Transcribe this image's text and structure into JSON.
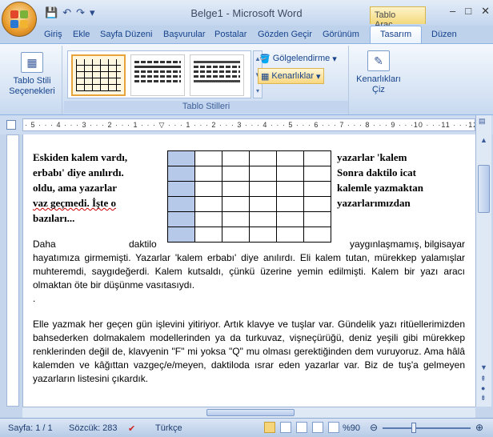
{
  "window": {
    "title": "Belge1 - Microsoft Word",
    "context_tab": "Tablo Araç...",
    "minimize": "–",
    "maximize": "□",
    "close": "✕"
  },
  "tabs": [
    "Giriş",
    "Ekle",
    "Sayfa Düzeni",
    "Başvurular",
    "Postalar",
    "Gözden Geçir",
    "Görünüm",
    "Tasarım",
    "Düzen"
  ],
  "active_tab": "Tasarım",
  "ribbon": {
    "table_style_options": "Tablo Stili Seçenekleri",
    "shading": "Gölgelendirme",
    "borders": "Kenarlıklar",
    "draw_borders": "Kenarlıkları Çiz",
    "group_table_styles": "Tablo Stilleri"
  },
  "ruler": {
    "text": "· 5 · · · 4 · · · 3 · · · 2 · · · 1 · · · ▽ · · · 1 · · · 2 · · · 3 · · · 4 · · · 5 · · · 6 · · · 7 · · · 8 · · · 9 · · ·10 · · ·11 · · ·12 · · ·13 · · ·14 · · ·15"
  },
  "document": {
    "bold_left": [
      "Eskiden kalem vardı,",
      "erbabı' diye anılırdı.",
      "oldu, ama yazarlar",
      "vaz geçmedi. İşte o",
      "bazıları..."
    ],
    "bold_right": [
      "yazarlar 'kalem",
      "Sonra daktilo icat",
      "kalemle yazmaktan",
      "yazarlarımızdan"
    ],
    "para1_start_left": "Daha",
    "para1_start_mid": "daktilo",
    "para1_start_right": "yaygınlaşmamış, bilgisayar",
    "para1_rest": "hayatımıza girmemişti. Yazarlar 'kalem erbabı' diye anılırdı. Eli kalem tutan, mürekkep yalamışlar muhteremdi, saygıdeğerdi. Kalem kutsaldı, çünkü üzerine yemin edilmişti. Kalem bir yazı aracı olmaktan öte bir düşünme vasıtasıydı.",
    "dot": ".",
    "para2": "Elle yazmak her geçen gün işlevini yitiriyor. Artık klavye ve tuşlar var. Gündelik yazı ritüellerimizden bahsederken dolmakalem modellerinden ya da turkuvaz, vişneçürüğü, deniz yeşili gibi mürekkep renklerinden değil de, klavyenin \"F\" mi yoksa \"Q\" mu olması gerektiğinden dem vuruyoruz. Ama hâlâ kalemden ve kâğıttan vazgeç/e/meyen, daktiloda ısrar eden yazarlar var. Biz de tuş'a gelmeyen yazarların listesini çıkardık."
  },
  "status": {
    "page": "Sayfa: 1 / 1",
    "words": "Sözcük: 283",
    "language": "Türkçe",
    "zoom": "%90"
  },
  "colors": {
    "accent": "#f3d97c",
    "table_highlight": "#b7c9e9"
  }
}
